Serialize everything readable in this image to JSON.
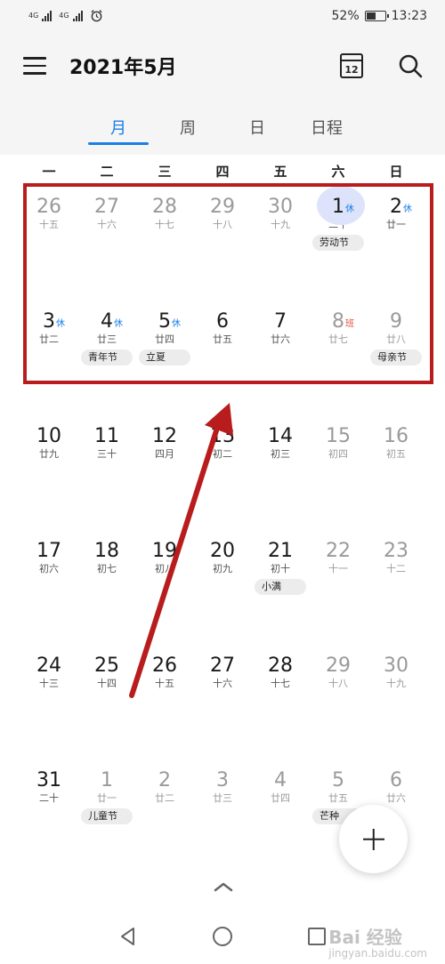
{
  "status_bar": {
    "network_1": "4G",
    "network_2": "4G",
    "battery_percent": "52%",
    "battery_level": 0.52,
    "time": "13:23"
  },
  "app_bar": {
    "title": "2021年5月",
    "calendar_icon_day": "12"
  },
  "tabs": [
    {
      "label": "月",
      "active": true
    },
    {
      "label": "周",
      "active": false
    },
    {
      "label": "日",
      "active": false
    },
    {
      "label": "日程",
      "active": false
    }
  ],
  "weekdays": [
    "一",
    "二",
    "三",
    "四",
    "五",
    "六",
    "日"
  ],
  "weeks": [
    [
      {
        "day": "26",
        "lunar": "十五",
        "dim": true
      },
      {
        "day": "27",
        "lunar": "十六",
        "dim": true
      },
      {
        "day": "28",
        "lunar": "十七",
        "dim": true
      },
      {
        "day": "29",
        "lunar": "十八",
        "dim": true
      },
      {
        "day": "30",
        "lunar": "十九",
        "dim": true
      },
      {
        "day": "1",
        "lunar": "二十",
        "badge": "休",
        "badge_type": "rest",
        "today": true
      },
      {
        "day": "2",
        "lunar": "廿一",
        "badge": "休",
        "badge_type": "rest"
      }
    ],
    [
      {
        "day": "3",
        "lunar": "廿二",
        "badge": "休",
        "badge_type": "rest"
      },
      {
        "day": "4",
        "lunar": "廿三",
        "badge": "休",
        "badge_type": "rest"
      },
      {
        "day": "5",
        "lunar": "廿四",
        "badge": "休",
        "badge_type": "rest"
      },
      {
        "day": "6",
        "lunar": "廿五"
      },
      {
        "day": "7",
        "lunar": "廿六"
      },
      {
        "day": "8",
        "lunar": "廿七",
        "badge": "班",
        "badge_type": "work",
        "weekend": true
      },
      {
        "day": "9",
        "lunar": "廿八",
        "weekend": true
      }
    ],
    [
      {
        "day": "10",
        "lunar": "廿九"
      },
      {
        "day": "11",
        "lunar": "三十"
      },
      {
        "day": "12",
        "lunar": "四月"
      },
      {
        "day": "13",
        "lunar": "初二"
      },
      {
        "day": "14",
        "lunar": "初三"
      },
      {
        "day": "15",
        "lunar": "初四",
        "weekend": true
      },
      {
        "day": "16",
        "lunar": "初五",
        "weekend": true
      }
    ],
    [
      {
        "day": "17",
        "lunar": "初六"
      },
      {
        "day": "18",
        "lunar": "初七"
      },
      {
        "day": "19",
        "lunar": "初八"
      },
      {
        "day": "20",
        "lunar": "初九"
      },
      {
        "day": "21",
        "lunar": "初十"
      },
      {
        "day": "22",
        "lunar": "十一",
        "weekend": true
      },
      {
        "day": "23",
        "lunar": "十二",
        "weekend": true
      }
    ],
    [
      {
        "day": "24",
        "lunar": "十三"
      },
      {
        "day": "25",
        "lunar": "十四"
      },
      {
        "day": "26",
        "lunar": "十五"
      },
      {
        "day": "27",
        "lunar": "十六"
      },
      {
        "day": "28",
        "lunar": "十七"
      },
      {
        "day": "29",
        "lunar": "十八",
        "weekend": true
      },
      {
        "day": "30",
        "lunar": "十九",
        "weekend": true
      }
    ],
    [
      {
        "day": "31",
        "lunar": "二十"
      },
      {
        "day": "1",
        "lunar": "廿一",
        "dim": true
      },
      {
        "day": "2",
        "lunar": "廿二",
        "dim": true
      },
      {
        "day": "3",
        "lunar": "廿三",
        "dim": true
      },
      {
        "day": "4",
        "lunar": "廿四",
        "dim": true
      },
      {
        "day": "5",
        "lunar": "廿五",
        "dim": true
      },
      {
        "day": "6",
        "lunar": "廿六",
        "dim": true
      }
    ]
  ],
  "holidays": [
    {
      "week": 0,
      "col": 5,
      "span": 1,
      "label": "劳动节"
    },
    {
      "week": 1,
      "col": 1,
      "span": 1,
      "label": "青年节"
    },
    {
      "week": 1,
      "col": 2,
      "span": 1,
      "label": "立夏"
    },
    {
      "week": 1,
      "col": 6,
      "span": 1,
      "label": "母亲节"
    },
    {
      "week": 3,
      "col": 4,
      "span": 1,
      "label": "小满"
    },
    {
      "week": 5,
      "col": 1,
      "span": 1,
      "label": "儿童节"
    },
    {
      "week": 5,
      "col": 5,
      "span": 1,
      "label": "芒种"
    }
  ],
  "watermark": {
    "brand": "Bai 经验",
    "url": "jingyan.baidu.com"
  },
  "colors": {
    "accent": "#1a7ee6",
    "annotation": "#b81c1c",
    "today_circle": "#dde3fb",
    "work_badge": "#e34b3a"
  }
}
